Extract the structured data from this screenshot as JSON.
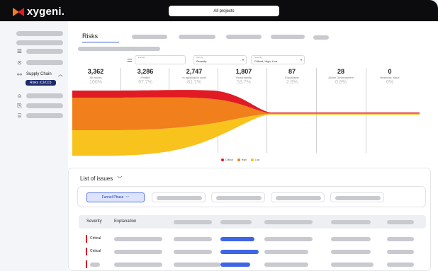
{
  "header": {
    "logo_text": "xygeni.",
    "project_selector": "All projects"
  },
  "sidebar": {
    "supply_chain_label": "Supply Chain",
    "active_badge": "Risks (CI/CD)"
  },
  "main": {
    "tabs": {
      "active": "Risks"
    },
    "filters": {
      "funnel": {
        "label": "Funnel",
        "value": ""
      },
      "sort": {
        "label": "Sort by",
        "value": "Severity"
      },
      "severity": {
        "label": "Severity",
        "value": "Critical, High, Low"
      }
    },
    "stats": [
      {
        "value": "3,362",
        "label": "All issues",
        "pct": "100%"
      },
      {
        "value": "3,286",
        "label": "Fixable",
        "pct": "97.7%"
      },
      {
        "value": "2,747",
        "label": "In application code",
        "pct": "81.7%"
      },
      {
        "value": "1,807",
        "label": "Reachability",
        "pct": "53.7%"
      },
      {
        "value": "87",
        "label": "Exploitable",
        "pct": "2.6%"
      },
      {
        "value": "28",
        "label": "Active Development",
        "pct": "0.8%"
      },
      {
        "value": "0",
        "label": "Business Value",
        "pct": "0%"
      }
    ],
    "legend": [
      {
        "name": "Critical",
        "color": "#e01b24"
      },
      {
        "name": "High",
        "color": "#f07f1c"
      },
      {
        "name": "Low",
        "color": "#f7c31c"
      }
    ],
    "issues": {
      "title": "List of issues",
      "funnel_button": "Funnel Phase",
      "columns": {
        "severity": "Severity",
        "explanation": "Explanation"
      },
      "rows": [
        {
          "severity": "Critical"
        },
        {
          "severity": "Critical"
        },
        {
          "severity": ""
        }
      ]
    }
  }
}
